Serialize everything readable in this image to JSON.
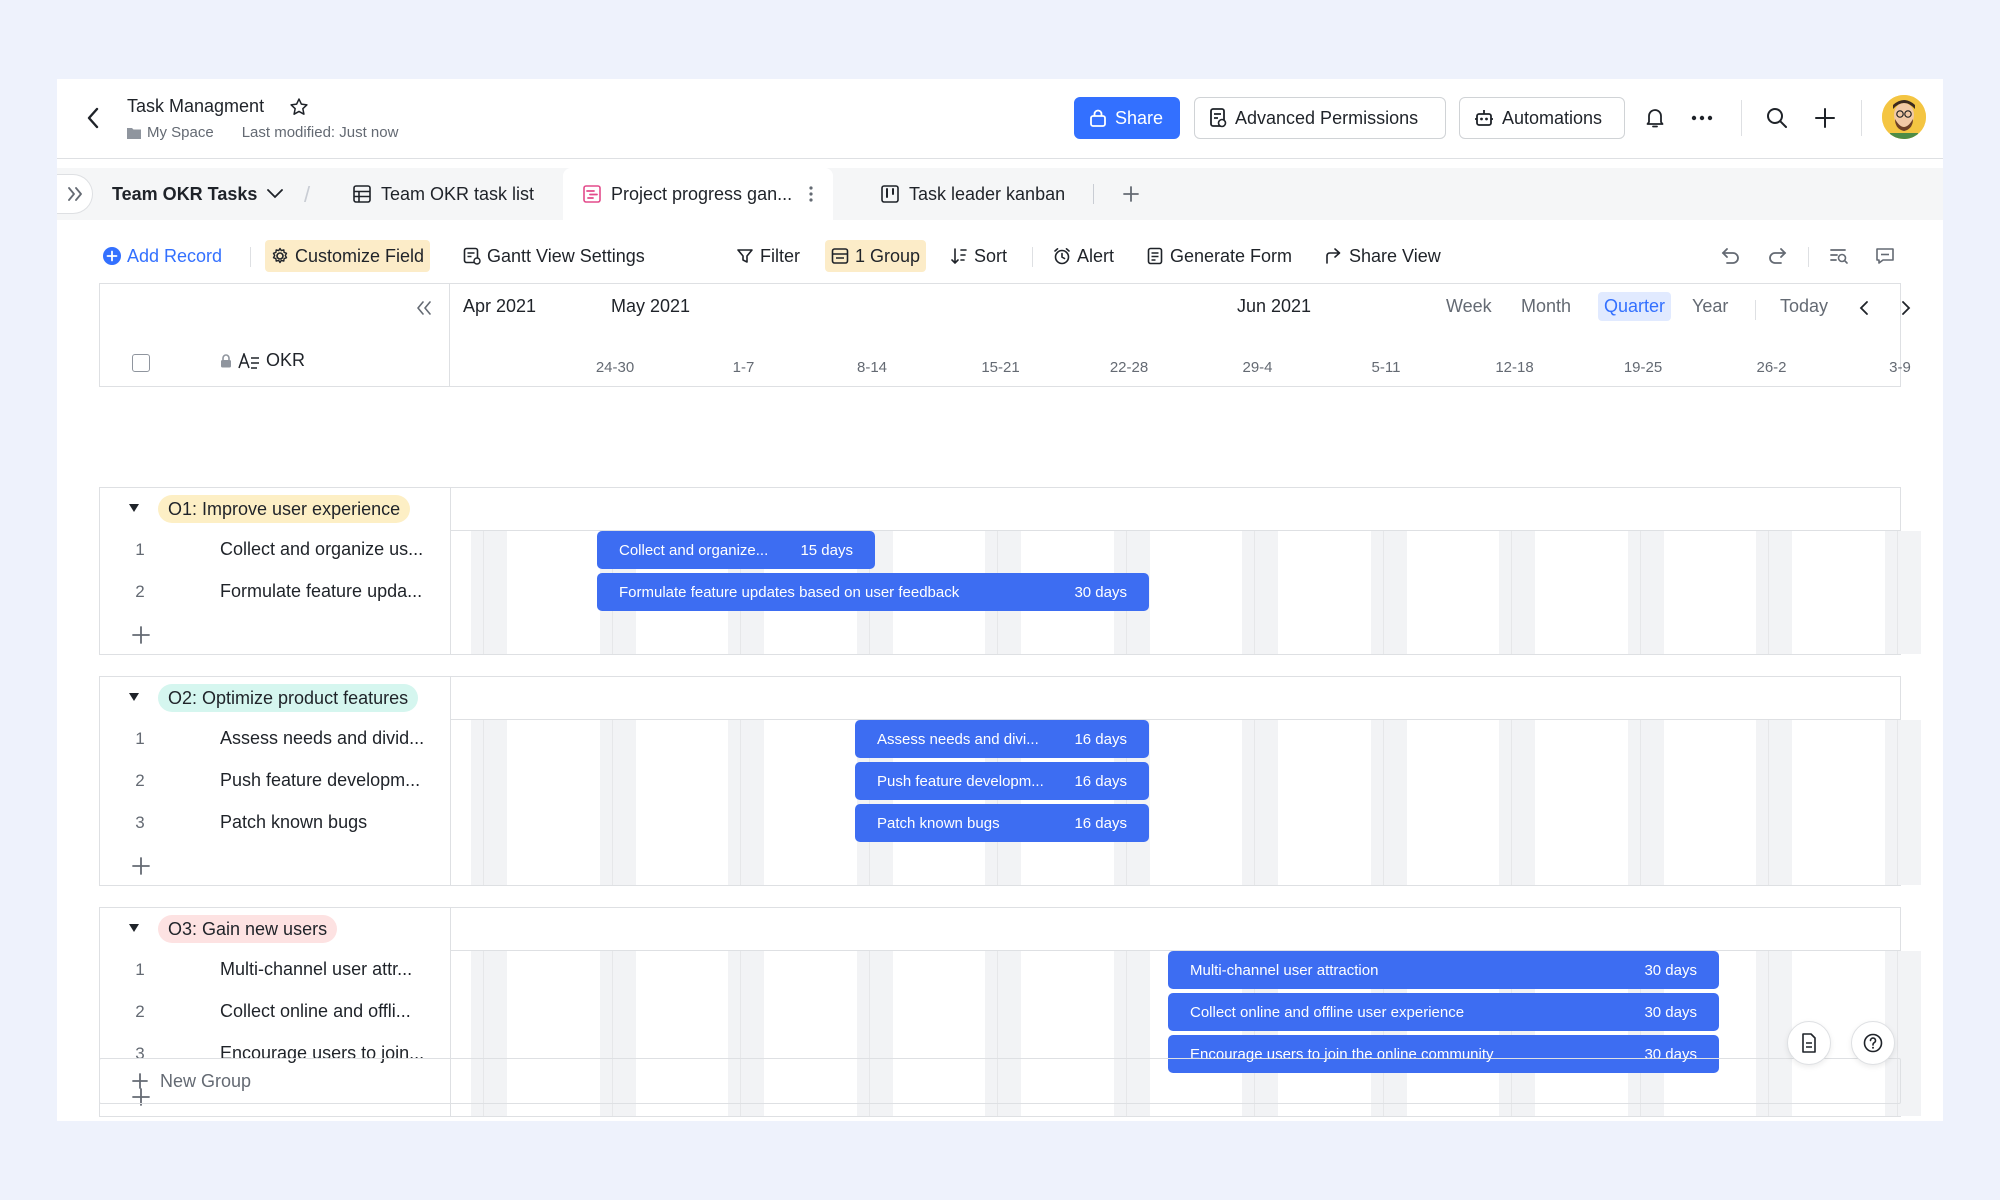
{
  "header": {
    "title": "Task Managment",
    "space": "My Space",
    "last_modified": "Last modified: Just now",
    "share": "Share",
    "advanced_permissions": "Advanced Permissions",
    "automations": "Automations"
  },
  "tabs": {
    "base": "Team OKR Tasks",
    "items": [
      {
        "label": "Team OKR task list",
        "icon": "grid-icon"
      },
      {
        "label": "Project progress gan...",
        "icon": "gantt-icon",
        "active": true
      },
      {
        "label": "Task leader kanban",
        "icon": "kanban-icon"
      }
    ]
  },
  "toolbar": {
    "add_record": "Add Record",
    "customize_field": "Customize Field",
    "gantt_settings": "Gantt View Settings",
    "filter": "Filter",
    "group": "1 Group",
    "sort": "Sort",
    "alert": "Alert",
    "generate_form": "Generate Form",
    "share_view": "Share View"
  },
  "timeline": {
    "months": [
      "Apr 2021",
      "May 2021",
      "Jun 2021"
    ],
    "weeks": [
      "24-30",
      "1-7",
      "8-14",
      "15-21",
      "22-28",
      "29-4",
      "5-11",
      "12-18",
      "19-25",
      "26-2",
      "3-9"
    ],
    "scales": [
      "Week",
      "Month",
      "Quarter",
      "Year"
    ],
    "selected_scale": "Quarter",
    "today": "Today",
    "field_header": "OKR"
  },
  "groups": [
    {
      "name": "O1: Improve user experience",
      "color": "#fdefc5",
      "rows": [
        {
          "num": "1",
          "title": "Collect and organize us...",
          "bar_label": "Collect and organize...",
          "duration": "15 days"
        },
        {
          "num": "2",
          "title": "Formulate feature upda...",
          "bar_label": "Formulate feature updates based on user feedback",
          "duration": "30 days"
        }
      ]
    },
    {
      "name": "O2: Optimize product features",
      "color": "#d5f6ef",
      "rows": [
        {
          "num": "1",
          "title": "Assess needs and divid...",
          "bar_label": "Assess needs and divi...",
          "duration": "16 days"
        },
        {
          "num": "2",
          "title": "Push feature developm...",
          "bar_label": "Push feature developm...",
          "duration": "16 days"
        },
        {
          "num": "3",
          "title": "Patch known bugs",
          "bar_label": "Patch known bugs",
          "duration": "16 days"
        }
      ]
    },
    {
      "name": "O3: Gain new users",
      "color": "#fde2e2",
      "rows": [
        {
          "num": "1",
          "title": "Multi-channel user attr...",
          "bar_label": "Multi-channel user attraction",
          "duration": "30 days"
        },
        {
          "num": "2",
          "title": "Collect online and offli...",
          "bar_label": "Collect online and offline user experience",
          "duration": "30 days"
        },
        {
          "num": "3",
          "title": "Encourage users to join...",
          "bar_label": "Encourage users to join the online community",
          "duration": "30 days"
        }
      ]
    }
  ],
  "new_group": "New Group",
  "colors": {
    "accent": "#3370ff",
    "bar": "#3d6df2"
  }
}
